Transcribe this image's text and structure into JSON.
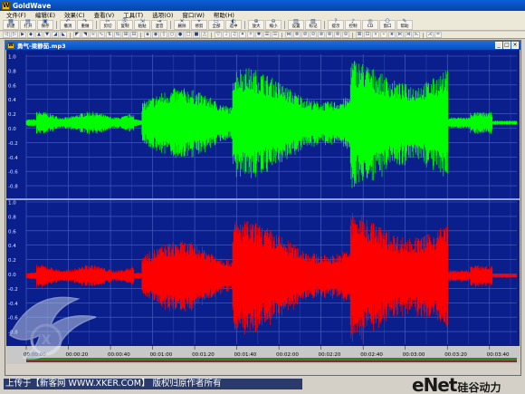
{
  "app": {
    "title": "GoldWave"
  },
  "menu": [
    "文件(F)",
    "编辑(E)",
    "效果(C)",
    "查看(V)",
    "工具(T)",
    "选项(O)",
    "窗口(W)",
    "帮助(H)"
  ],
  "toolbar1": {
    "labeled": [
      {
        "glyph": "▦",
        "label": "新建"
      },
      {
        "glyph": "▤",
        "label": "打开"
      },
      {
        "glyph": "▣",
        "label": "保存"
      },
      {
        "glyph": "↶",
        "label": "撤消"
      },
      {
        "glyph": "↷",
        "label": "重做"
      },
      {
        "glyph": "✂",
        "label": "剪切"
      },
      {
        "glyph": "⎘",
        "label": "复制"
      },
      {
        "glyph": "⇲",
        "label": "粘贴"
      },
      {
        "glyph": "⇥",
        "label": "混音"
      },
      {
        "glyph": "✕",
        "label": "删除"
      },
      {
        "glyph": "⌖",
        "label": "修剪"
      },
      {
        "glyph": "▭",
        "label": "全部"
      },
      {
        "glyph": "◐",
        "label": "选中"
      },
      {
        "glyph": "⊕",
        "label": "放大"
      },
      {
        "glyph": "⊖",
        "label": "缩小"
      },
      {
        "glyph": "▥",
        "label": "设置"
      },
      {
        "glyph": "▧",
        "label": "标记"
      },
      {
        "glyph": "?",
        "label": "提示"
      },
      {
        "glyph": "♪",
        "label": "控制"
      },
      {
        "glyph": "◎",
        "label": "CD"
      },
      {
        "glyph": "⎔",
        "label": "窗口"
      },
      {
        "glyph": "✎",
        "label": "帮助"
      }
    ]
  },
  "toolbar2": {
    "icons": [
      "◁",
      "▷",
      "▶",
      "◆",
      "▲",
      "▼",
      "◢",
      "◣",
      "◤",
      "◥",
      "≈",
      "∿",
      "⇅",
      "⇆",
      "⊞",
      "⊟",
      "◈",
      "◉",
      "◊",
      "○",
      "●",
      "□",
      "■",
      "△",
      "▽",
      "♩",
      "♫",
      "✦",
      "✧",
      "✱",
      "☰",
      "☷",
      "⋈",
      "⊗",
      "⊘",
      "⊙",
      "⊚",
      "⊛",
      "⊜",
      "⊝",
      "⊠",
      "⊡",
      "⋄",
      "⋆",
      "⋇",
      "⋉",
      "⋊",
      "⋋",
      "⋌",
      "⋍"
    ]
  },
  "document": {
    "title": "勇气-梁静茹.mp3"
  },
  "waveform": {
    "channels": [
      {
        "name": "left",
        "color": "#00ff00"
      },
      {
        "name": "right",
        "color": "#ff0000"
      }
    ],
    "amplitude_labels": [
      "1.0",
      "0.8",
      "0.6",
      "0.4",
      "0.2",
      "0.0",
      "-0.2",
      "-0.4",
      "-0.6",
      "-0.8"
    ],
    "time_labels": [
      "00:00:00",
      "00:00:20",
      "00:00:40",
      "00:01:00",
      "00:01:20",
      "00:01:40",
      "00:02:00",
      "00:02:20",
      "00:02:40",
      "00:03:00",
      "00:03:20",
      "00:03:40"
    ],
    "bg_color": "#0a1e8c",
    "grid_color": "#4a66c8"
  },
  "watermark": {
    "upload_text": "上传于【新客网 WWW.XKER.COM】 版权归原作者所有",
    "logo_text": "eNet",
    "logo_sub": "硅谷动力"
  }
}
